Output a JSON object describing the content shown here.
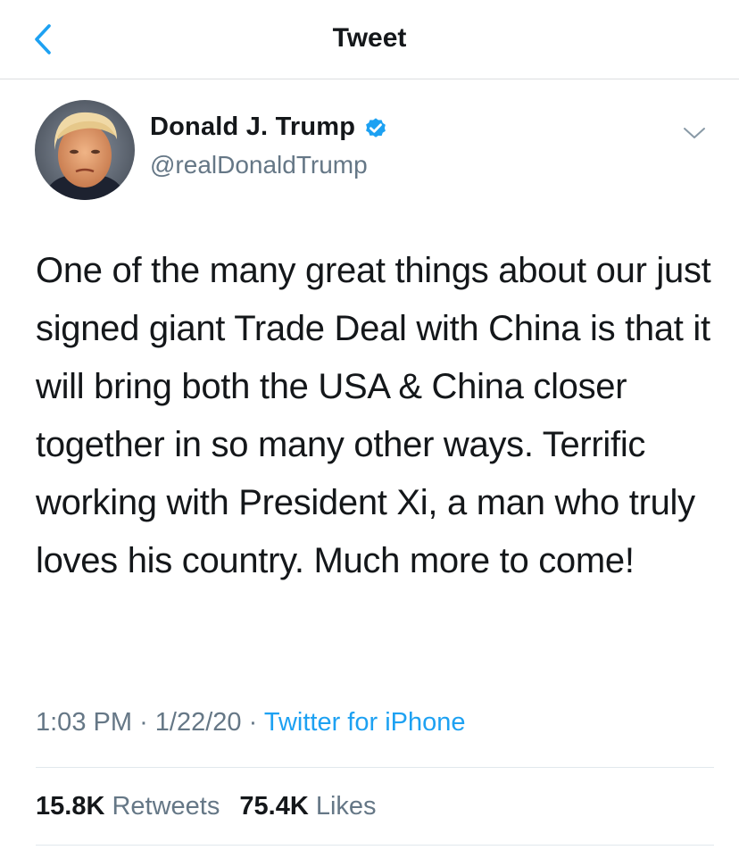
{
  "header": {
    "title": "Tweet",
    "back_icon": "chevron-left-icon"
  },
  "author": {
    "display_name": "Donald J. Trump",
    "handle": "@realDonaldTrump",
    "verified_icon": "verified-badge-icon",
    "menu_icon": "chevron-down-icon"
  },
  "tweet": {
    "text": "One of the many great things about our just signed giant Trade Deal with China is that it will bring both the USA & China closer together in so many other ways. Terrific working with President Xi, a man who truly loves his country. Much more to come!",
    "time": "1:03 PM",
    "date": "1/22/20",
    "separator": "·",
    "source": "Twitter for iPhone"
  },
  "stats": {
    "retweets_count": "15.8K",
    "retweets_label": "Retweets",
    "likes_count": "75.4K",
    "likes_label": "Likes"
  },
  "colors": {
    "accent": "#1da1f2",
    "text_primary": "#14171a",
    "text_secondary": "#657786",
    "divider": "#e1e8ed"
  }
}
